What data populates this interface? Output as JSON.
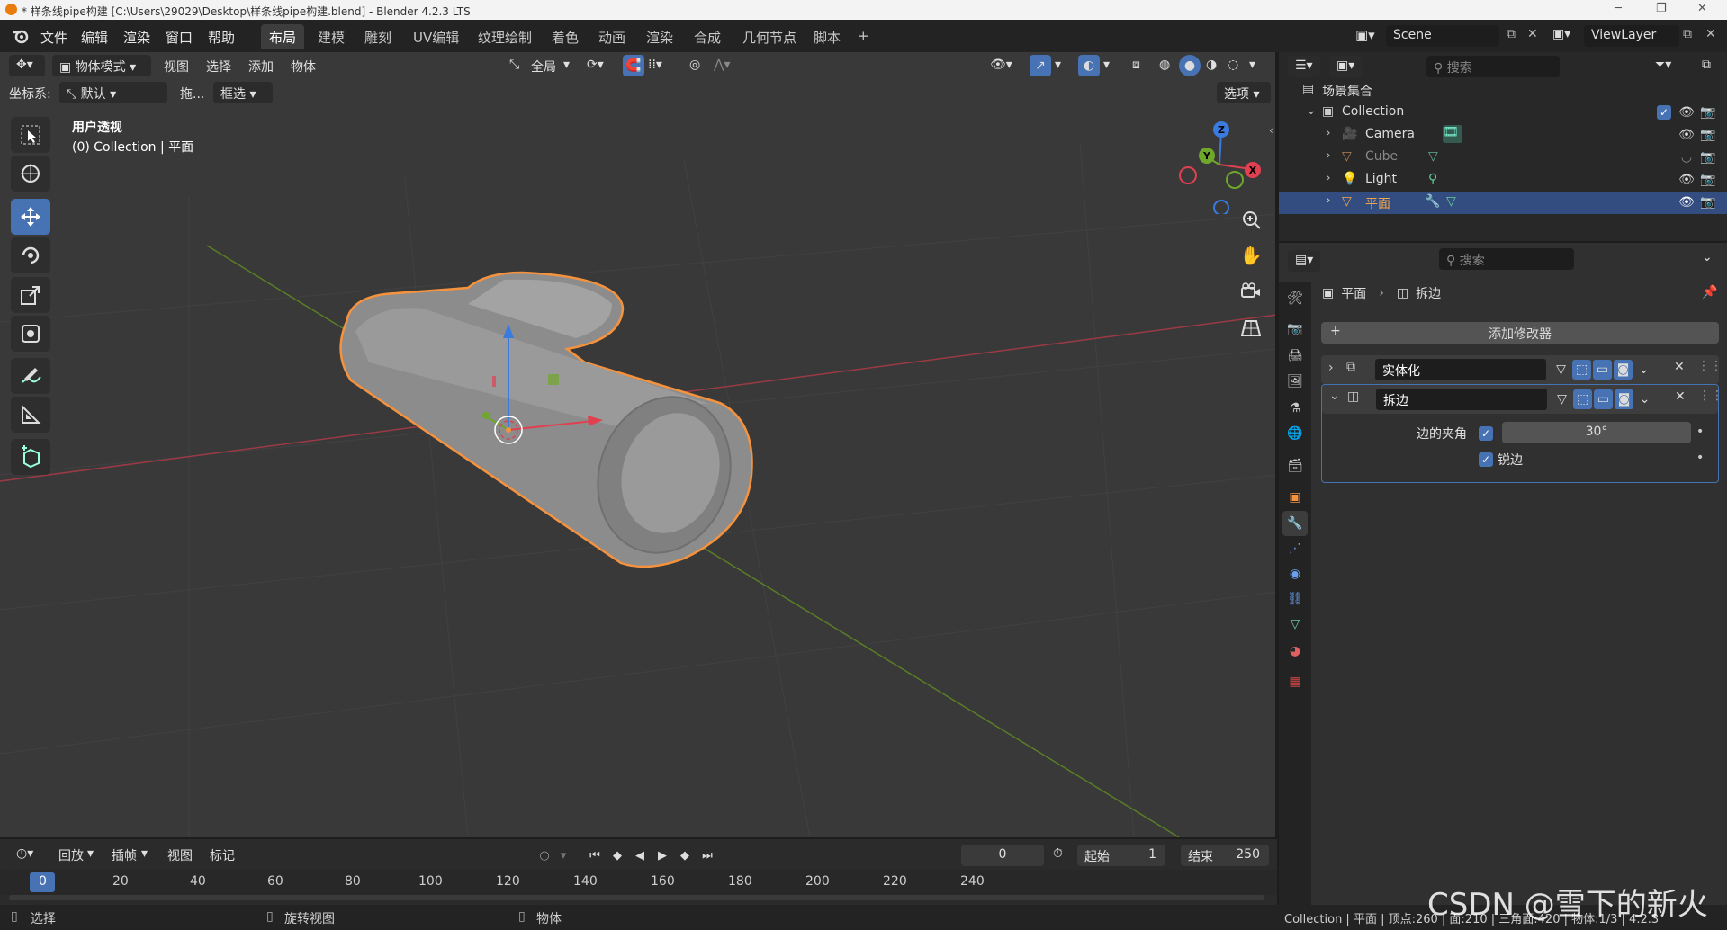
{
  "window": {
    "title": "* 样条线pipe构建 [C:\\Users\\29029\\Desktop\\样条线pipe构建.blend] - Blender 4.2.3 LTS"
  },
  "menubar": {
    "menus": [
      "文件",
      "编辑",
      "渲染",
      "窗口",
      "帮助"
    ],
    "workspaces": [
      "布局",
      "建模",
      "雕刻",
      "UV编辑",
      "纹理绘制",
      "着色",
      "动画",
      "渲染",
      "合成",
      "几何节点",
      "脚本"
    ],
    "active_workspace": "布局",
    "add_tab": "+",
    "scene": "Scene",
    "view_layer": "ViewLayer"
  },
  "viewport": {
    "mode": "物体模式",
    "menus": [
      "视图",
      "选择",
      "添加",
      "物体"
    ],
    "transform_orientation": "全局",
    "coord_label": "坐标系:",
    "coord_value": "默认",
    "drag_label": "拖...",
    "select_mode": "框选",
    "options": "选项",
    "view_name": "用户透视",
    "view_context": "(0) Collection | 平面",
    "gizmo_axes": {
      "x": "X",
      "y": "Y",
      "z": "Z"
    }
  },
  "toolbar": {
    "tools": [
      "select-box",
      "cursor",
      "move",
      "rotate",
      "scale",
      "transform",
      "annotate",
      "measure",
      "add-cube"
    ],
    "active_tool": "move"
  },
  "timeline": {
    "menus": [
      "回放",
      "插帧",
      "视图",
      "标记"
    ],
    "current_frame": "0",
    "start_label": "起始",
    "start": "1",
    "end_label": "结束",
    "end": "250",
    "ticks": [
      "0",
      "20",
      "40",
      "60",
      "80",
      "100",
      "120",
      "140",
      "160",
      "180",
      "200",
      "220",
      "240"
    ]
  },
  "statusbar": {
    "left": "选择",
    "middle": "旋转视图",
    "right": "物体",
    "stats": "Collection | 平面 | 顶点:260 | 面:210 | 三角面:420 | 物体:1/3 | 4.2.3"
  },
  "outliner": {
    "search_placeholder": "搜索",
    "root": "场景集合",
    "collection": "Collection",
    "items": [
      {
        "name": "Camera",
        "type": "camera"
      },
      {
        "name": "Cube",
        "type": "mesh"
      },
      {
        "name": "Light",
        "type": "light"
      },
      {
        "name": "平面",
        "type": "mesh"
      }
    ],
    "selected": "平面"
  },
  "properties": {
    "search_placeholder": "搜索",
    "breadcrumb_object": "平面",
    "breadcrumb_modifier": "拆边",
    "add_modifier": "添加修改器",
    "modifiers": [
      {
        "name": "实体化",
        "expanded": false
      },
      {
        "name": "拆边",
        "expanded": true
      }
    ],
    "edge_angle_label": "边的夹角",
    "edge_angle_value": "30°",
    "sharp_label": "锐边"
  },
  "watermark": "CSDN @雪下的新火",
  "colors": {
    "accent": "#4772b3",
    "selection_outline": "#f5923e",
    "axis_x": "#e04050",
    "axis_y": "#6fa72a",
    "axis_z": "#3a7be0"
  }
}
